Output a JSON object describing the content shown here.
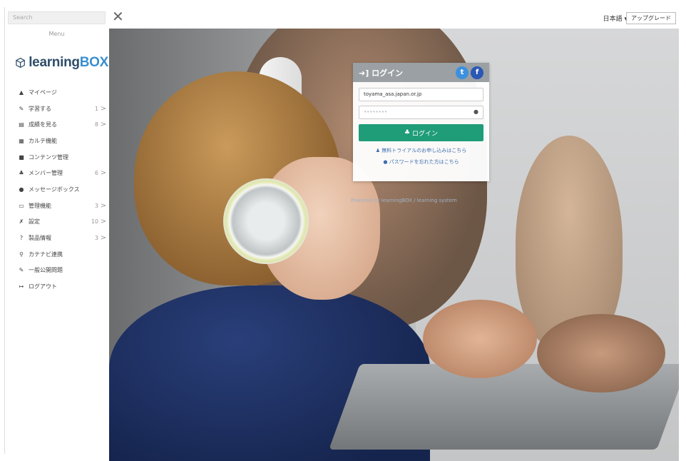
{
  "sidebar": {
    "search_placeholder": "Search",
    "menu_label": "Menu",
    "logo": {
      "text_main": "learning",
      "text_accent": "BOX"
    },
    "items": [
      {
        "icon": "person-icon",
        "glyph": "▲",
        "label": "マイページ",
        "count": "",
        "chevron": ""
      },
      {
        "icon": "pencil-icon",
        "glyph": "✎",
        "label": "学習する",
        "count": "1",
        "chevron": ">"
      },
      {
        "icon": "chart-icon",
        "glyph": "▤",
        "label": "成績を見る",
        "count": "8",
        "chevron": ">"
      },
      {
        "icon": "table-icon",
        "glyph": "▦",
        "label": "カルテ機能",
        "count": "",
        "chevron": ""
      },
      {
        "icon": "folder-icon",
        "glyph": "■",
        "label": "コンテンツ管理",
        "count": "",
        "chevron": ""
      },
      {
        "icon": "users-icon",
        "glyph": "♣",
        "label": "メンバー管理",
        "count": "6",
        "chevron": ">"
      },
      {
        "icon": "message-icon",
        "glyph": "●",
        "label": "メッセージボックス",
        "count": "",
        "chevron": ""
      },
      {
        "icon": "monitor-icon",
        "glyph": "▭",
        "label": "管理機能",
        "count": "3",
        "chevron": ">"
      },
      {
        "icon": "wrench-icon",
        "glyph": "✗",
        "label": "設定",
        "count": "10",
        "chevron": ">"
      },
      {
        "icon": "question-icon",
        "glyph": "?",
        "label": "製品情報",
        "count": "3",
        "chevron": ">"
      },
      {
        "icon": "link-icon",
        "glyph": "⚲",
        "label": "カテナビ連携",
        "count": "",
        "chevron": ""
      },
      {
        "icon": "pencil-icon",
        "glyph": "✎",
        "label": "一般公開問題",
        "count": "",
        "chevron": ""
      },
      {
        "icon": "logout-icon",
        "glyph": "↦",
        "label": "ログアウト",
        "count": "",
        "chevron": ""
      }
    ]
  },
  "topbar": {
    "close_glyph": "✕",
    "language": "日本語 ▾",
    "upgrade": "アップグレード"
  },
  "login": {
    "title": "ログイン",
    "title_glyph": "➜]",
    "sns": {
      "twitter": "t",
      "facebook": "f"
    },
    "username_value": "toyama_asa.japan.or.jp",
    "password_value": "••••••••",
    "eye_glyph": "●",
    "button_label": "ログイン",
    "button_glyph": "♣",
    "trial_link": "無料トライアルのお申し込みはこちら",
    "trial_glyph": "♟",
    "forgot_link": "パスワードを忘れた方はこちら",
    "forgot_glyph": "●"
  },
  "photo_caption": "Powered by learningBOX / learning system"
}
